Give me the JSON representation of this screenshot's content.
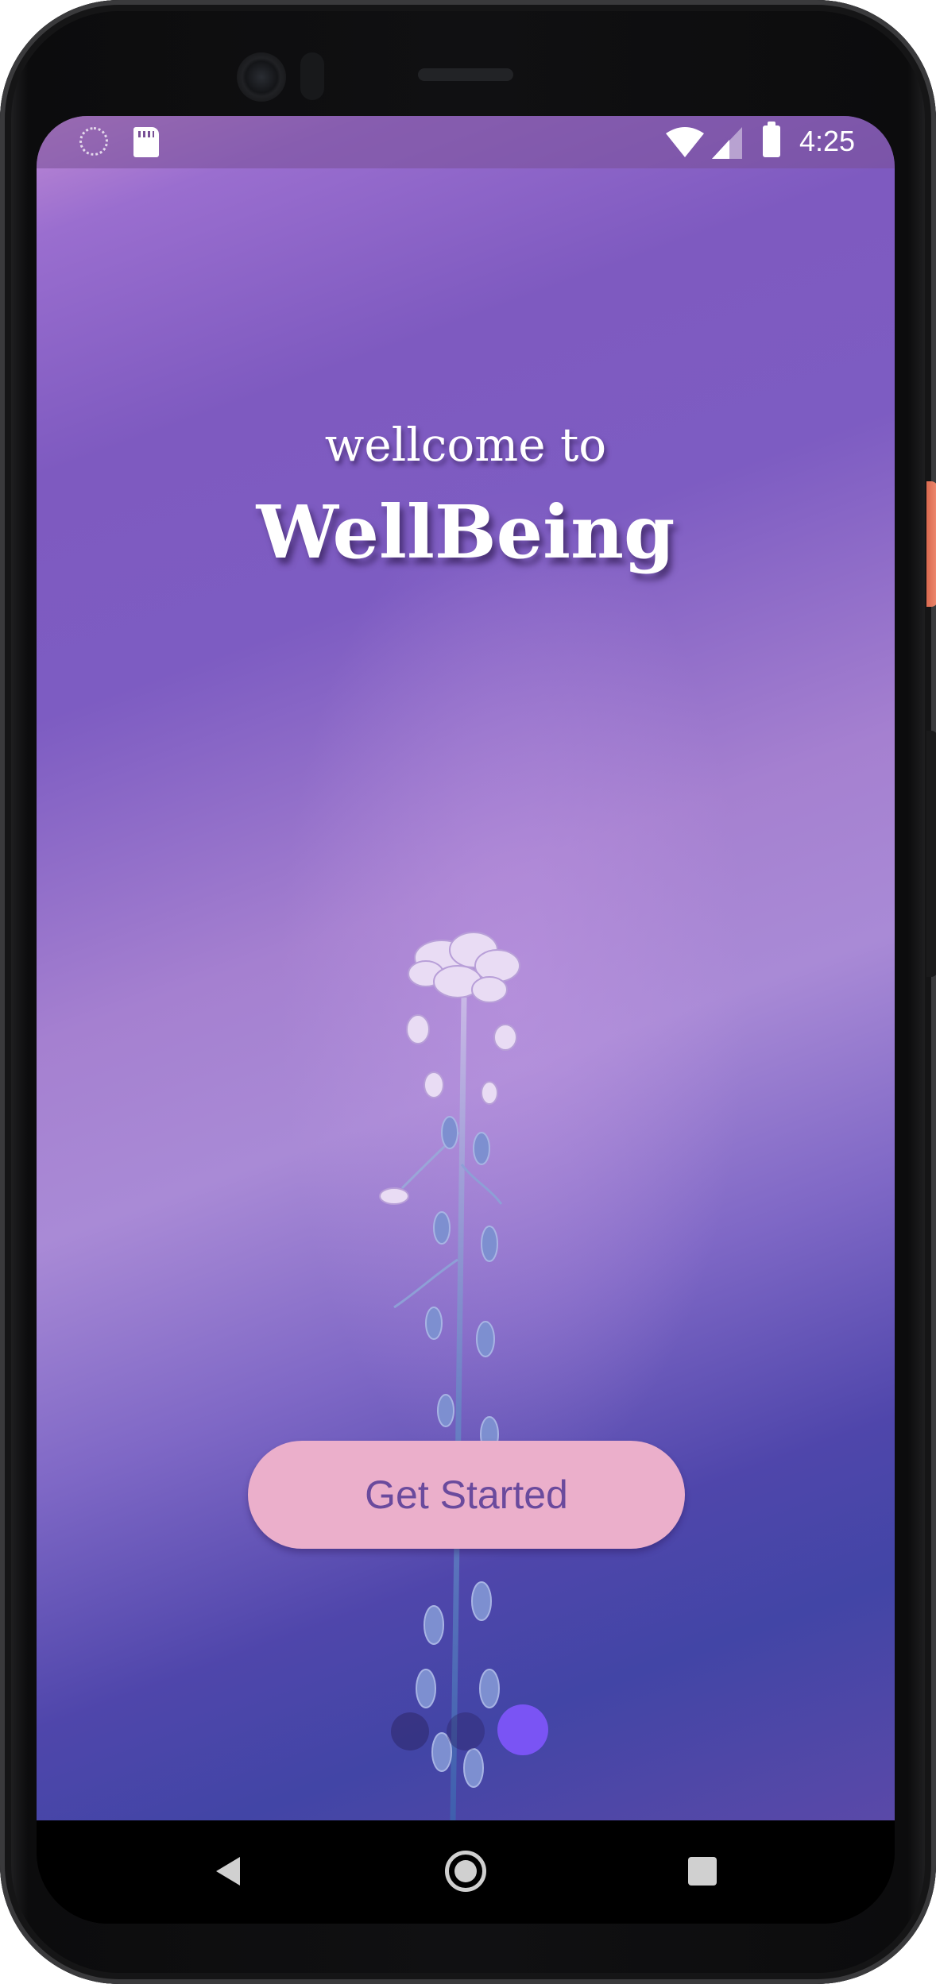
{
  "status_bar": {
    "time": "4:25",
    "icons": [
      "sync-icon",
      "sd-card-icon",
      "wifi-icon",
      "cell-signal-icon",
      "battery-icon"
    ]
  },
  "welcome": {
    "subtitle": "wellcome to",
    "title": "WellBeing"
  },
  "cta": {
    "label": "Get Started"
  },
  "pager": {
    "page_count": 3,
    "active_index": 2,
    "active_color": "#7a54f4"
  },
  "nav_bar": {
    "icons": [
      "back-icon",
      "home-icon",
      "recents-icon"
    ]
  },
  "colors": {
    "button_bg": "#ebafcb",
    "button_text": "#6a4a9d",
    "gradient_top": "#c08bd4",
    "gradient_mid": "#7e5ac0",
    "gradient_bottom": "#4245a6"
  }
}
